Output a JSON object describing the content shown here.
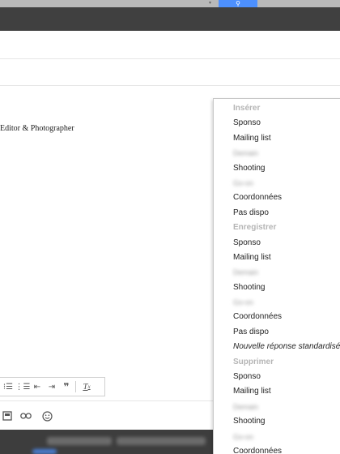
{
  "signature": {
    "line": "Editor & Photographer"
  },
  "dropdown": {
    "items": [
      {
        "label": "Insérer",
        "type": "header"
      },
      {
        "label": "Sponso",
        "type": "item"
      },
      {
        "label": "Mailing list",
        "type": "item"
      },
      {
        "label": "Demain",
        "type": "blurred"
      },
      {
        "label": "Shooting",
        "type": "item"
      },
      {
        "label": "Go-on",
        "type": "blurred"
      },
      {
        "label": "Coordonnées",
        "type": "item"
      },
      {
        "label": "Pas dispo",
        "type": "item"
      },
      {
        "label": "Enregistrer",
        "type": "header"
      },
      {
        "label": "Sponso",
        "type": "item"
      },
      {
        "label": "Mailing list",
        "type": "item"
      },
      {
        "label": "Demain",
        "type": "blurred"
      },
      {
        "label": "Shooting",
        "type": "item"
      },
      {
        "label": "Go-on",
        "type": "blurred"
      },
      {
        "label": "Coordonnées",
        "type": "item"
      },
      {
        "label": "Pas dispo",
        "type": "item"
      },
      {
        "label": "Nouvelle réponse standardisée",
        "type": "italic"
      },
      {
        "label": "Supprimer",
        "type": "header"
      },
      {
        "label": "Sponso",
        "type": "item"
      },
      {
        "label": "Mailing list",
        "type": "item"
      },
      {
        "label": "Demain",
        "type": "blurred"
      },
      {
        "label": "Shooting",
        "type": "item"
      },
      {
        "label": "Go-on",
        "type": "blurred"
      },
      {
        "label": "Coordonnées",
        "type": "item"
      }
    ]
  },
  "format_toolbar": {
    "icons": [
      "numbered-list-icon",
      "bulleted-list-icon",
      "indent-less-icon",
      "indent-more-icon",
      "quote-icon",
      "remove-formatting-icon"
    ]
  },
  "bottom_toolbar": {
    "icons": [
      "insert-photo-icon",
      "insert-link-icon",
      "insert-emoji-icon"
    ]
  },
  "colors": {
    "accent": "#4d90fe",
    "dark_band": "#404040",
    "status_bar": "#3d3d3d",
    "menu_header": "#b5b5b5"
  }
}
